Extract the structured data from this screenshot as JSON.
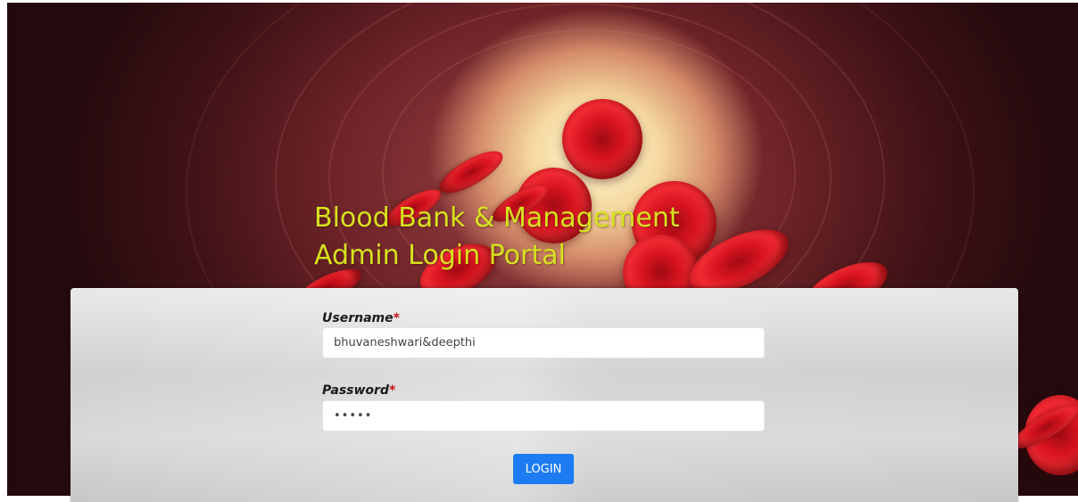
{
  "header": {
    "title_line1": "Blood Bank & Management",
    "title_line2": "Admin Login Portal",
    "title_color": "#d6e21f"
  },
  "form": {
    "username_label": "Username",
    "password_label": "Password",
    "required_marker": "*",
    "username_value": "bhuvaneshwari&deepthi",
    "password_value": "•••••",
    "login_label": "LOGIN",
    "login_color": "#1e7cf2"
  }
}
